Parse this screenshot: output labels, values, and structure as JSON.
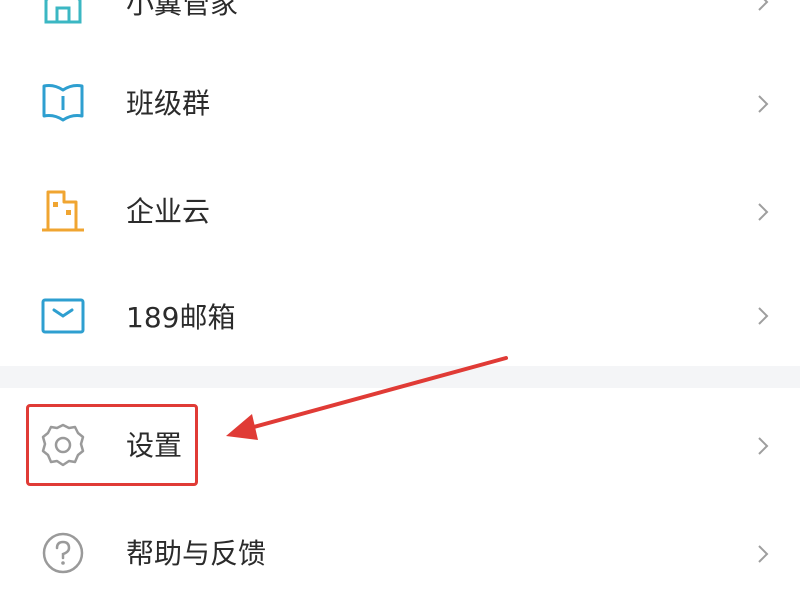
{
  "menu": {
    "items": [
      {
        "label": "小翼管家",
        "icon": "home-icon",
        "color": "#3bb7c3"
      },
      {
        "label": "班级群",
        "icon": "book-icon",
        "color": "#2e9fd0"
      },
      {
        "label": "企业云",
        "icon": "building-icon",
        "color": "#f0a531"
      },
      {
        "label": "189邮箱",
        "icon": "mail-icon",
        "color": "#2e9fd0"
      },
      {
        "label": "设置",
        "icon": "gear-icon",
        "color": "#9a9a9a"
      },
      {
        "label": "帮助与反馈",
        "icon": "help-icon",
        "color": "#9a9a9a"
      }
    ]
  },
  "annotation": {
    "color": "#e03b36"
  }
}
